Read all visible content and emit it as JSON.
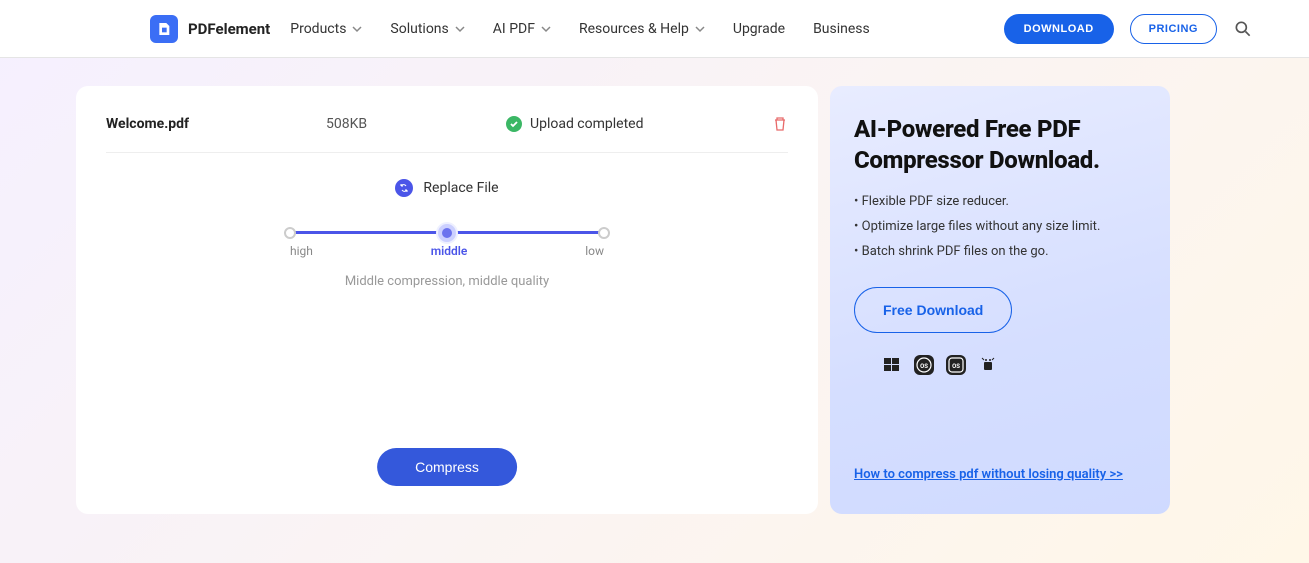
{
  "header": {
    "brand": "PDFelement",
    "nav": [
      "Products",
      "Solutions",
      "AI PDF",
      "Resources & Help",
      "Upgrade",
      "Business"
    ],
    "download_label": "DOWNLOAD",
    "pricing_label": "PRICING"
  },
  "file": {
    "name": "Welcome.pdf",
    "size": "508KB",
    "status": "Upload completed"
  },
  "replace_label": "Replace File",
  "slider": {
    "high": "high",
    "middle": "middle",
    "low": "low",
    "desc": "Middle compression, middle quality"
  },
  "compress_label": "Compress",
  "sidebar": {
    "title": "AI-Powered Free PDF Compressor Download.",
    "bullets": [
      "Flexible PDF size reducer.",
      "Optimize large files without any size limit.",
      "Batch shrink PDF files on the go."
    ],
    "free_download": "Free Download",
    "howto": "How to compress pdf without losing quality >>"
  }
}
